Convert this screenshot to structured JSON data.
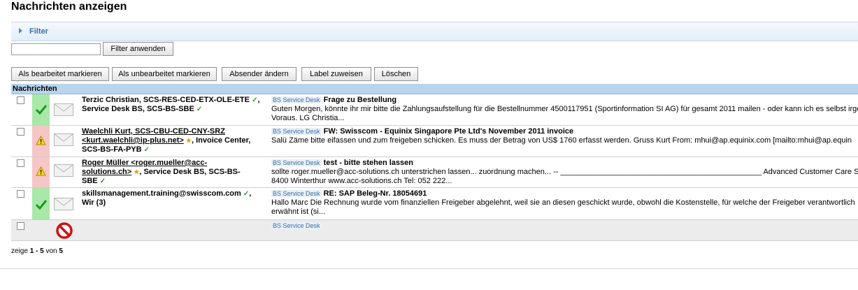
{
  "page": {
    "title": "Nachrichten anzeigen"
  },
  "filter": {
    "label": "Filter",
    "input_value": "",
    "apply_label": "Filter anwenden"
  },
  "toolbar": {
    "mark_done": "Als bearbeitet markieren",
    "mark_undone": "Als unbearbeitet markieren",
    "change_sender": "Absender ändern",
    "assign_label": "Label zuweisen",
    "delete": "Löschen"
  },
  "grid": {
    "header": "Nachrichten",
    "rows": [
      {
        "status": "ok",
        "sender_line1": "Terzic Christian, SCS-RES-CED-ETX-OLE-ETE",
        "sender_line2": "Service Desk BS, SCS-BS-SBE",
        "tag": "BS Service Desk",
        "subject": "Frage zu Bestellung",
        "excerpt1": "Guten Morgen,   könnte ihr mir bitte die Zahlungsaufstellung für die Bestellnummer 4500117951 (Sportinformation SI AG) für gesamt 2011 mailen - oder kann ich es selbst irgen",
        "excerpt2": "Voraus. LG Christia..."
      },
      {
        "status": "warn",
        "sender_line1": "Waelchli Kurt, SCS-CBU-CED-CNY-SRZ",
        "sender_line2": "<kurt.waelchli@ip-plus.net>",
        "sender_line2b": ", Invoice Center,",
        "sender_line3": "SCS-BS-FA-PYB",
        "tag": "BS Service Desk",
        "subject": "FW: Swisscom - Equinix Singapore Pte Ltd's November 2011 invoice",
        "excerpt1": "Salü Zäme   bitte eifassen und zum freigeben schicken.   Es muss der Betrag von US$ 1760 erfasst werden.   Gruss Kurt   From: mhui@ap.equinix.com [mailto:mhui@ap.equin"
      },
      {
        "status": "warn",
        "sender_line1": "Roger Müller <roger.mueller@acc-",
        "sender_line2": "solutions.ch>",
        "sender_line2b": ", Service Desk BS, SCS-BS-",
        "sender_line3": "SBE",
        "tag": "BS Service Desk",
        "subject": "test - bitte stehen lassen",
        "excerpt1": "sollte roger.mueller@acc-solutions.ch unterstrichen lassen... zuordnung machen... -- _______________________________________________ Advanced Customer Care So",
        "excerpt2": "8400 Winterthur www.acc-solutions.ch Tel: 052 222..."
      },
      {
        "status": "ok",
        "sender_line1": "skillsmanagement.training@swisscom.com",
        "sender_line2": "Wir (3)",
        "tag": "BS Service Desk",
        "subject": "RE: SAP Beleg-Nr. 18054691",
        "excerpt1": "Hallo Marc   Die Rechnung wurde vom finanziellen Freigeber abgelehnt, weil sie an diesen geschickt wurde, obwohl die Kostenstelle, für welche der Freigeber verantwortlich",
        "excerpt2": "erwähnt ist (si..."
      },
      {
        "status": "blocked",
        "tag": "BS Service Desk"
      }
    ]
  },
  "pager": {
    "prefix": "zeige",
    "from": "1",
    "sep": "-",
    "to": "5",
    "of": "von",
    "total": "5"
  },
  "colors": {
    "accent": "#3a6ea5",
    "header_bg": "#b8d4ee",
    "ok": "#a8e8a8",
    "warn": "#f6c6c6"
  }
}
